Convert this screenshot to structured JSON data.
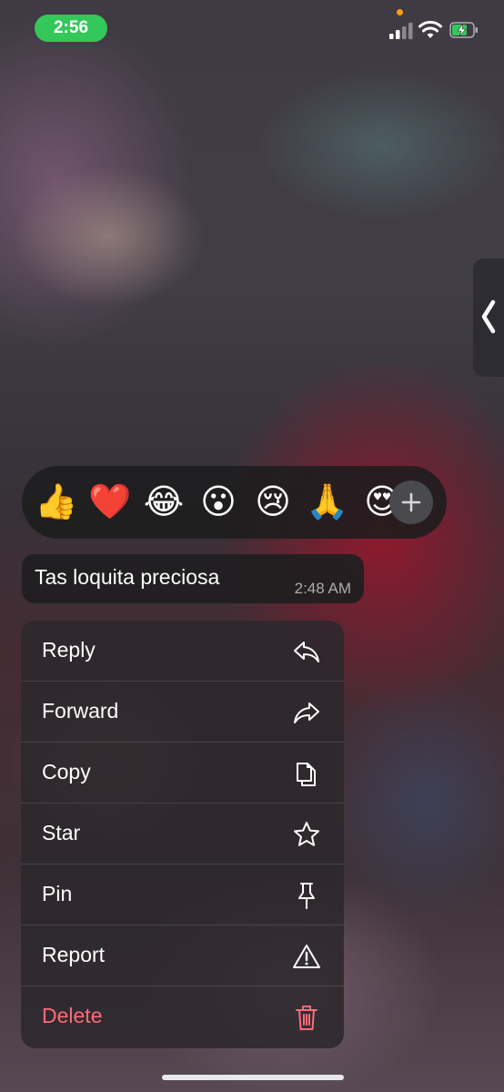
{
  "status_bar": {
    "time": "2:56",
    "time_pill_color": "#34c759",
    "icons": [
      "privacy-dot",
      "signal-icon",
      "wifi-icon",
      "battery-charging-icon"
    ]
  },
  "side_handle": {
    "icon": "chevron-left-icon"
  },
  "reactions": {
    "emojis": [
      "👍",
      "❤️",
      "😂",
      "😮",
      "😢",
      "🙏",
      "😍"
    ],
    "add_icon": "plus-icon"
  },
  "message": {
    "text": "Tas loquita preciosa",
    "time": "2:48 AM"
  },
  "menu": {
    "items": [
      {
        "label": "Reply",
        "icon": "reply-icon"
      },
      {
        "label": "Forward",
        "icon": "forward-icon"
      },
      {
        "label": "Copy",
        "icon": "copy-icon"
      },
      {
        "label": "Star",
        "icon": "star-icon"
      },
      {
        "label": "Pin",
        "icon": "pin-icon"
      },
      {
        "label": "Report",
        "icon": "warning-icon"
      },
      {
        "label": "Delete",
        "icon": "trash-icon",
        "color": "#ff6b7a"
      }
    ]
  }
}
